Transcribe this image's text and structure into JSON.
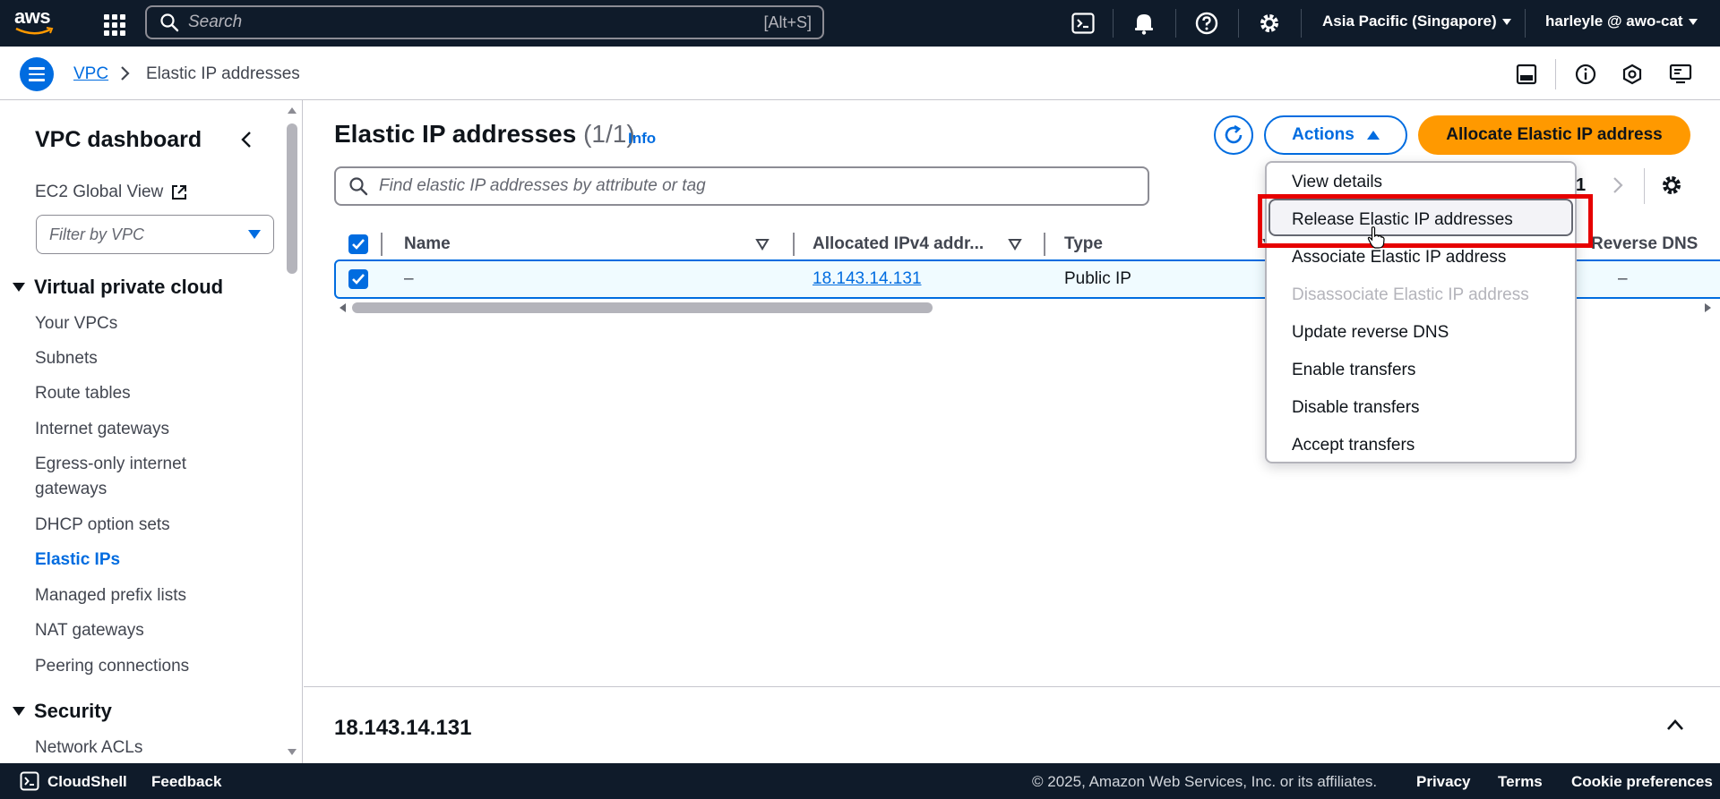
{
  "topnav": {
    "logo_text": "aws",
    "search_placeholder": "Search",
    "search_shortcut": "[Alt+S]",
    "region": "Asia Pacific (Singapore)",
    "account": "harleyle @ awo-cat"
  },
  "breadcrumb": {
    "root": "VPC",
    "current": "Elastic IP addresses"
  },
  "sidebar": {
    "title": "VPC dashboard",
    "ec2_global_view": "EC2 Global View",
    "filter_placeholder": "Filter by VPC",
    "sections": [
      {
        "heading": "Virtual private cloud",
        "items": [
          {
            "label": "Your VPCs"
          },
          {
            "label": "Subnets"
          },
          {
            "label": "Route tables"
          },
          {
            "label": "Internet gateways"
          },
          {
            "label": "Egress-only internet gateways"
          },
          {
            "label": "DHCP option sets"
          },
          {
            "label": "Elastic IPs",
            "active": true
          },
          {
            "label": "Managed prefix lists"
          },
          {
            "label": "NAT gateways"
          },
          {
            "label": "Peering connections"
          }
        ]
      },
      {
        "heading": "Security",
        "items": [
          {
            "label": "Network ACLs"
          }
        ]
      }
    ]
  },
  "main": {
    "title": "Elastic IP addresses",
    "count": "(1/1)",
    "info": "Info",
    "actions_label": "Actions",
    "allocate_label": "Allocate Elastic IP address",
    "find_placeholder": "Find elastic IP addresses by attribute or tag",
    "page_number": "1",
    "columns": [
      "Name",
      "Allocated IPv4 addr...",
      "Type",
      "Reverse DNS"
    ],
    "rows": [
      {
        "name": "–",
        "ip": "18.143.14.131",
        "type": "Public IP",
        "reverse_dns": "–",
        "selected": true
      }
    ]
  },
  "actions_menu": {
    "items": [
      {
        "label": "View details",
        "disabled": false
      },
      {
        "label": "Release Elastic IP addresses",
        "disabled": false,
        "hovered": true
      },
      {
        "label": "Associate Elastic IP address",
        "disabled": false
      },
      {
        "label": "Disassociate Elastic IP address",
        "disabled": true
      },
      {
        "label": "Update reverse DNS",
        "disabled": false
      },
      {
        "label": "Enable transfers",
        "disabled": false
      },
      {
        "label": "Disable transfers",
        "disabled": false
      },
      {
        "label": "Accept transfers",
        "disabled": false
      }
    ]
  },
  "split_panel": {
    "title": "18.143.14.131"
  },
  "footer": {
    "cloudshell": "CloudShell",
    "feedback": "Feedback",
    "copyright": "© 2025, Amazon Web Services, Inc. or its affiliates.",
    "privacy": "Privacy",
    "terms": "Terms",
    "cookies": "Cookie preferences"
  },
  "colors": {
    "nav_bg": "#0f1b2a",
    "link_blue": "#006ce0",
    "primary_orange": "#ff9900",
    "highlight_red": "#e60000"
  },
  "icons": [
    "aws-logo",
    "apps-grid-icon",
    "search-icon",
    "cloudshell-icon",
    "bell-icon",
    "help-icon",
    "gear-icon",
    "hamburger-icon",
    "chevron-right-icon",
    "external-link-icon",
    "refresh-icon",
    "chevron-up-icon"
  ]
}
